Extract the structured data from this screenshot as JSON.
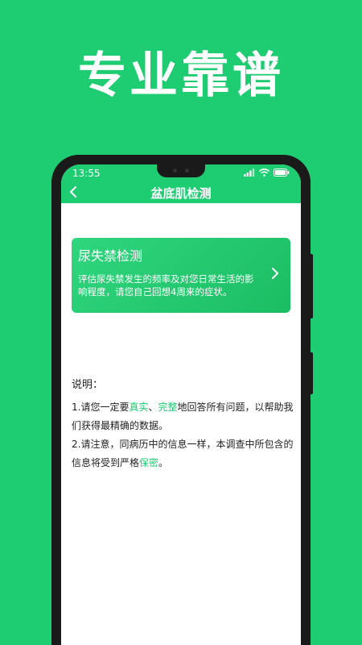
{
  "promo": {
    "title": "专业靠谱"
  },
  "status_bar": {
    "time": "13:55"
  },
  "nav": {
    "title": "盆底肌检测"
  },
  "card": {
    "title": "尿失禁检测",
    "description": "评估尿失禁发生的频率及对您日常生活的影响程度，请您自己回想4周来的症状。"
  },
  "notes": {
    "heading": "说明：",
    "item1": {
      "before": "1.请您一定要",
      "hl1": "真实",
      "sep": "、",
      "hl2": "完整",
      "after": "地回答所有问题，以帮助我们获得最精确的数据。"
    },
    "item2": {
      "before": "2.请注意，同病历中的信息一样，本调查中所包含的信息将受到严格",
      "hl": "保密",
      "after": "。"
    }
  },
  "colors": {
    "brand": "#1ecd72",
    "frame": "#1a1a1a",
    "text": "#222222"
  },
  "icons": {
    "back": "chevron-left-icon",
    "forward": "chevron-right-icon",
    "signal": "signal-icon",
    "wifi": "wifi-icon",
    "battery": "battery-icon"
  }
}
